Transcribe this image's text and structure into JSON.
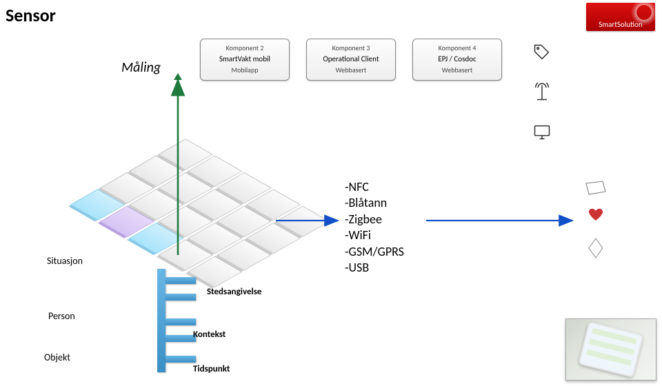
{
  "title": "Sensor",
  "brand": "SmartSolution",
  "left_label": "Måling",
  "components": [
    {
      "head": "Komponent 2",
      "mid": "SmartVakt mobil",
      "foot": "Mobilapp"
    },
    {
      "head": "Komponent 3",
      "mid": "Operational Client",
      "foot": "Webbasert"
    },
    {
      "head": "Komponent 4",
      "mid": "EPJ / Cosdoc",
      "foot": "Webbasert"
    }
  ],
  "protocols": [
    "-NFC",
    "-Blåtann",
    "-Zigbee",
    "-WiFi",
    "-GSM/GPRS",
    "-USB"
  ],
  "side_labels": {
    "situasjon": "Situasjon",
    "person": "Person",
    "objekt": "Objekt"
  },
  "branch_labels": {
    "steds": "Stedsangivelse",
    "kontekst": "Kontekst",
    "tidspunkt": "Tidspunkt"
  },
  "chart_data": {
    "type": "diagram",
    "title": "Sensor",
    "top_flow": {
      "input_label": "Måling",
      "components": [
        {
          "index": 2,
          "name": "SmartVakt mobil",
          "platform": "Mobilapp"
        },
        {
          "index": 3,
          "name": "Operational Client",
          "platform": "Webbasert"
        },
        {
          "index": 4,
          "name": "EPJ / Cosdoc",
          "platform": "Webbasert"
        }
      ]
    },
    "transports": [
      "NFC",
      "Blåtann",
      "Zigbee",
      "WiFi",
      "GSM/GPRS",
      "USB"
    ],
    "context_dimensions": [
      "Situasjon",
      "Person",
      "Objekt"
    ],
    "context_attributes": [
      "Stedsangivelse",
      "Kontekst",
      "Tidspunkt"
    ],
    "notes": "Isometric grid represents situational context; arrows indicate data flow Måling → components, grid → transports → devices."
  }
}
